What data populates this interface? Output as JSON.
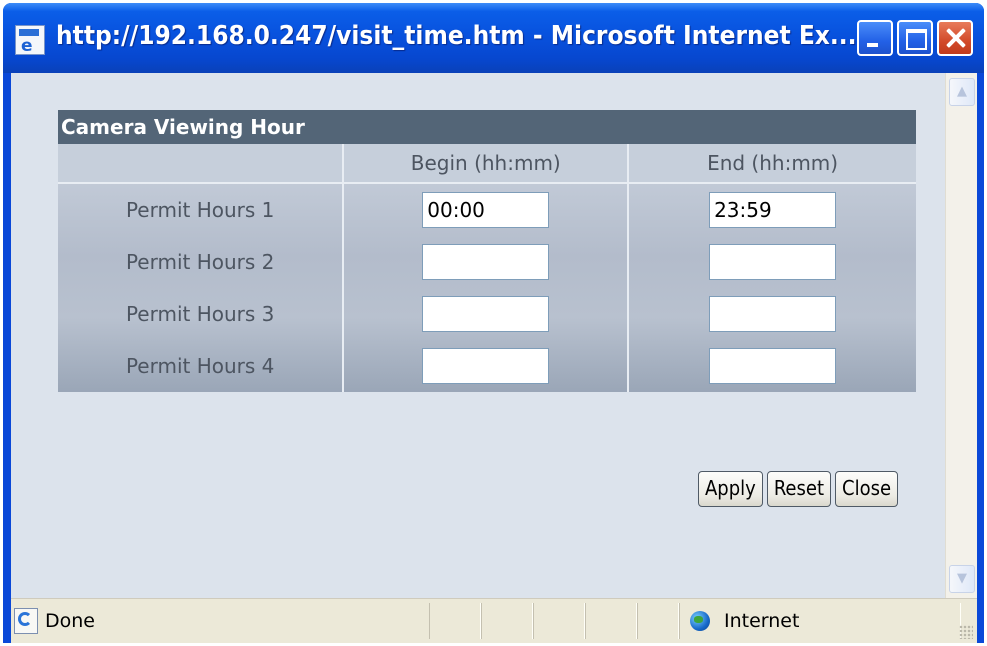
{
  "window": {
    "title": "http://192.168.0.247/visit_time.htm - Microsoft Internet Ex...",
    "buttons": {
      "minimize": "minimize",
      "maximize": "maximize",
      "close": "close"
    }
  },
  "panel": {
    "title": "Camera Viewing Hour",
    "columns": [
      "",
      "Begin (hh:mm)",
      "End (hh:mm)"
    ],
    "rows": [
      {
        "label": "Permit Hours 1",
        "begin": "00:00",
        "end": "23:59"
      },
      {
        "label": "Permit Hours 2",
        "begin": "",
        "end": ""
      },
      {
        "label": "Permit Hours 3",
        "begin": "",
        "end": ""
      },
      {
        "label": "Permit Hours 4",
        "begin": "",
        "end": ""
      }
    ]
  },
  "actions": {
    "apply": "Apply",
    "reset": "Reset",
    "close": "Close"
  },
  "statusbar": {
    "status": "Done",
    "zone": "Internet"
  },
  "icons": {
    "page": "ie-page-icon",
    "status": "ie-done-icon",
    "zone": "globe-icon"
  },
  "colors": {
    "titlebar": "#0852de",
    "panel_header": "#536577",
    "content_bg": "#dce3ec"
  }
}
